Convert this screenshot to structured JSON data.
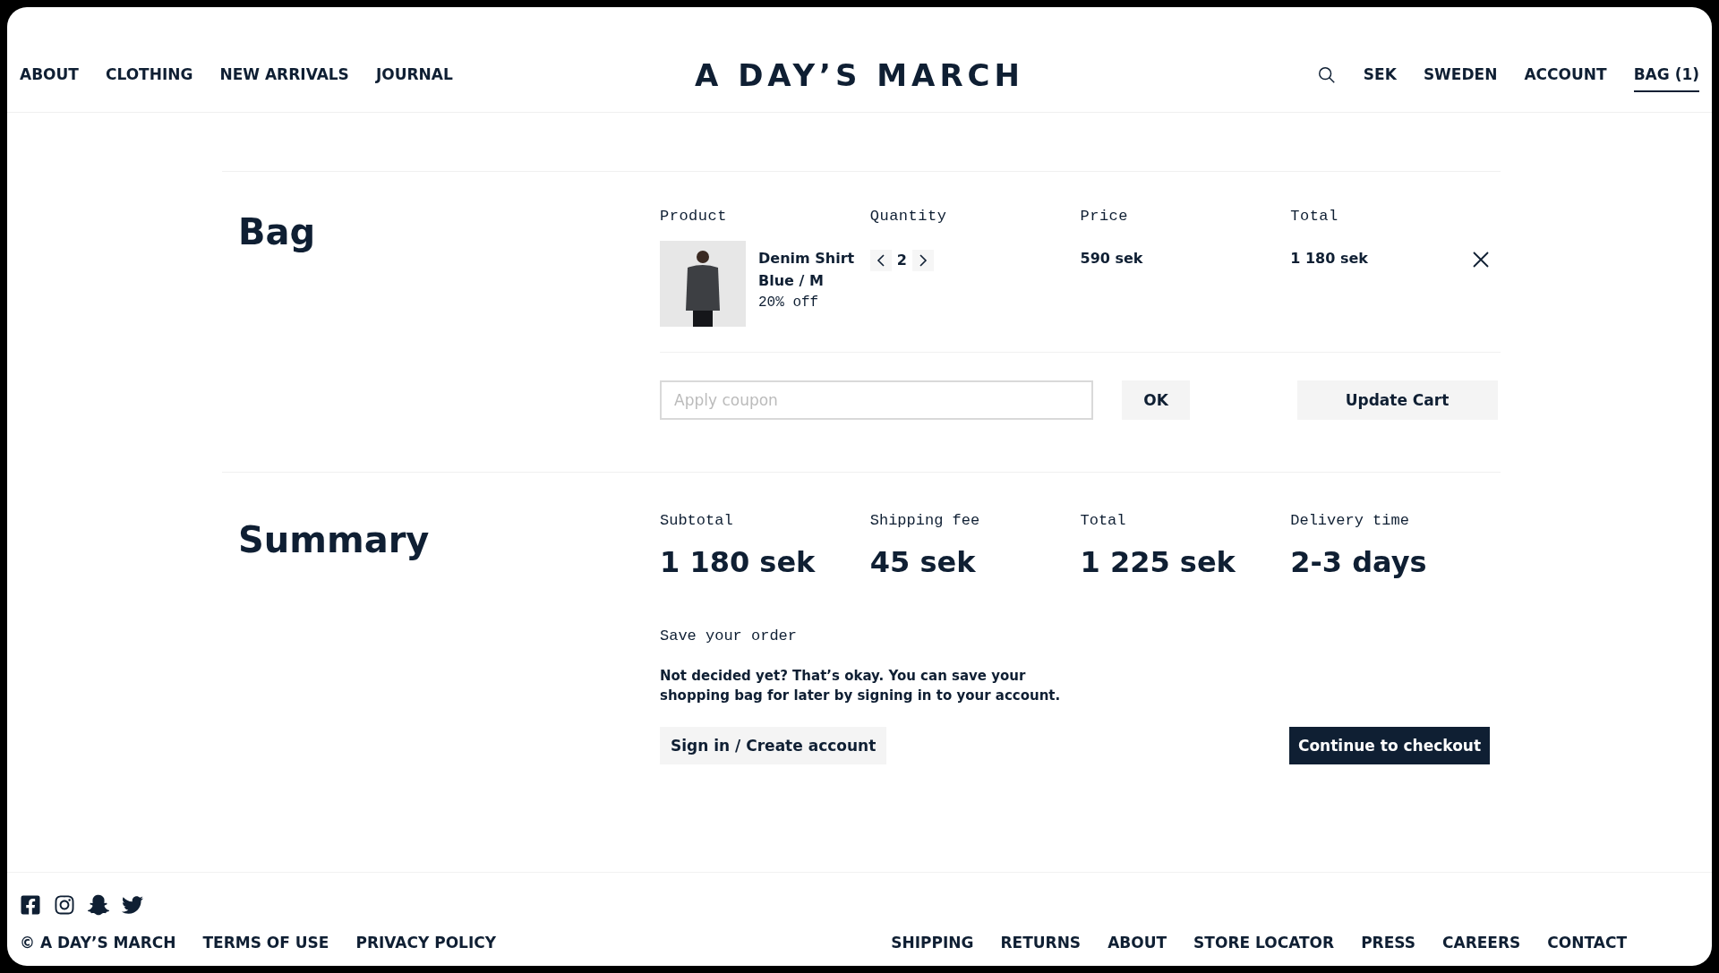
{
  "header": {
    "left_links": [
      "ABOUT",
      "CLOTHING",
      "NEW ARRIVALS",
      "JOURNAL"
    ],
    "logo": "A DAY’S MARCH",
    "right_links": [
      {
        "label": "SEK",
        "selected": false
      },
      {
        "label": "SWEDEN",
        "selected": false
      },
      {
        "label": "ACCOUNT",
        "selected": false
      },
      {
        "label": "BAG (1)",
        "selected": true
      }
    ]
  },
  "bag": {
    "title": "Bag",
    "columns": [
      "Product",
      "Quantity",
      "Price",
      "Total"
    ],
    "items": [
      {
        "name": "Denim Shirt",
        "variant": "Blue / M",
        "discount": "20% off",
        "quantity": "2",
        "price": "590 sek",
        "total": "1 180 sek"
      }
    ],
    "coupon": {
      "placeholder": "Apply coupon"
    },
    "ok_button": "OK",
    "update_button": "Update Cart"
  },
  "summary": {
    "title": "Summary",
    "stats": [
      {
        "label": "Subtotal",
        "value": "1 180 sek"
      },
      {
        "label": "Shipping fee",
        "value": "45 sek"
      },
      {
        "label": "Total",
        "value": "1 225 sek"
      },
      {
        "label": "Delivery time",
        "value": "2-3 days"
      }
    ],
    "save_title": "Save your order",
    "save_text": "Not decided yet? That’s okay. You can save your shopping bag for later by signing in to your account.",
    "sign_in_button": "Sign in / Create account",
    "checkout_button": "Continue to checkout"
  },
  "footer": {
    "left_links": [
      "© A DAY’S MARCH",
      "TERMS OF USE",
      "PRIVACY POLICY"
    ],
    "right_links": [
      "SHIPPING",
      "RETURNS",
      "ABOUT",
      "STORE LOCATOR",
      "PRESS",
      "CAREERS",
      "CONTACT"
    ]
  }
}
